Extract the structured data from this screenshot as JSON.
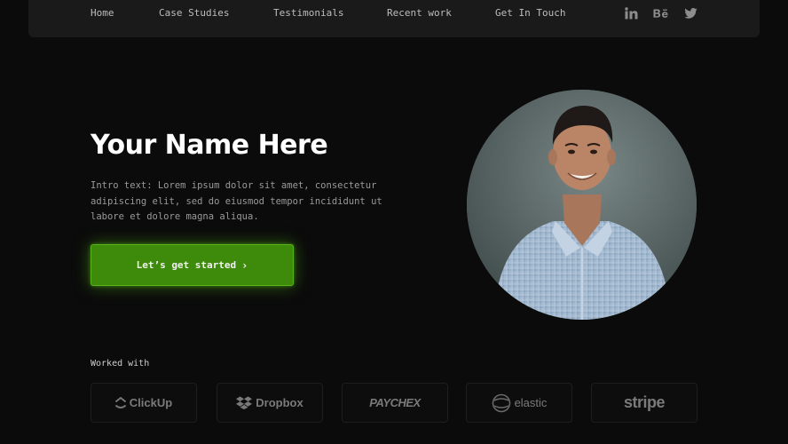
{
  "nav": {
    "links": [
      "Home",
      "Case Studies",
      "Testimonials",
      "Recent work",
      "Get In Touch"
    ],
    "social": [
      {
        "name": "linkedin-icon",
        "glyph": "in"
      },
      {
        "name": "behance-icon",
        "glyph": "Bē"
      },
      {
        "name": "twitter-icon",
        "glyph": ""
      }
    ]
  },
  "hero": {
    "title": "Your Name Here",
    "intro": "Intro text: Lorem ipsum dolor sit amet, consectetur adipiscing elit, sed do eiusmod tempor incididunt ut labore et dolore magna aliqua.",
    "cta_label": "Let’s get started",
    "cta_chevron": "›"
  },
  "worked_with": {
    "label": "Worked with",
    "logos": [
      "ClickUp",
      "Dropbox",
      "PAYCHEX",
      "elastic",
      "stripe"
    ]
  },
  "colors": {
    "background": "#0b0b0b",
    "navbar": "#1a1a1a",
    "accent_green": "#3e8a0b",
    "text_primary": "#ffffff",
    "text_muted": "#9a9a9a"
  }
}
